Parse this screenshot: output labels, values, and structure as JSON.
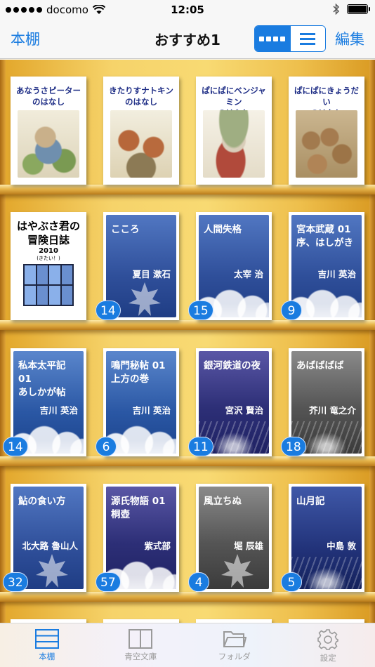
{
  "status_bar": {
    "carrier": "docomo",
    "time": "12:05"
  },
  "nav": {
    "back_label": "本棚",
    "title": "おすすめ1",
    "edit_label": "編集",
    "view_mode": "grid"
  },
  "accent_color": "#1a7ce0",
  "books": [
    {
      "title": "あなうさピーターのはなし",
      "author": "",
      "badge": ""
    },
    {
      "title": "きたりすナトキンのはなし",
      "author": "",
      "badge": ""
    },
    {
      "title": "ぱにぱにベンジャミンのはなし",
      "author": "",
      "badge": ""
    },
    {
      "title": "ぱにぱにきょうだいのはなし",
      "author": "",
      "badge": ""
    },
    {
      "title": "はやぶさ君の冒険日誌",
      "author": "",
      "badge": ""
    },
    {
      "title": "こころ",
      "author": "夏目 漱石",
      "badge": "14"
    },
    {
      "title": "人間失格",
      "author": "太宰 治",
      "badge": "15"
    },
    {
      "title": "宮本武蔵 01 序、はしがき",
      "author": "吉川 英治",
      "badge": "9"
    },
    {
      "title": "私本太平記 01 あしかが帖",
      "author": "吉川 英治",
      "badge": "14"
    },
    {
      "title": "鳴門秘帖 01 上方の巻",
      "author": "吉川 英治",
      "badge": "6"
    },
    {
      "title": "銀河鉄道の夜",
      "author": "宮沢 賢治",
      "badge": "11"
    },
    {
      "title": "あばばばば",
      "author": "芥川 竜之介",
      "badge": "18"
    },
    {
      "title": "鮎の食い方",
      "author": "北大路 魯山人",
      "badge": "32"
    },
    {
      "title": "源氏物語 01 桐壺",
      "author": "紫式部",
      "badge": "57"
    },
    {
      "title": "風立ちぬ",
      "author": "堀 辰雄",
      "badge": "4"
    },
    {
      "title": "山月記",
      "author": "中島 敦",
      "badge": "5"
    }
  ],
  "picture_books": {
    "b0": [
      "あなうさピーター",
      "のはなし"
    ],
    "b1": [
      "きたりすナトキン",
      "のはなし"
    ],
    "b2": [
      "ぱにぱにベンジャミン",
      "のはなし"
    ],
    "b3": [
      "ぱにぱにきょうだい",
      "のはなし"
    ]
  },
  "hayabusa": {
    "title_line1": "はやぶさ君の",
    "title_line2": "冒険日誌",
    "year": "2010",
    "sub": "(きたい！)"
  },
  "title_lines": {
    "b5": [
      "こころ"
    ],
    "b6": [
      "人間失格"
    ],
    "b7": [
      "宮本武蔵 01",
      "序、はしがき"
    ],
    "b8": [
      "私本太平記 01",
      "あしかが帖"
    ],
    "b9": [
      "鳴門秘帖 01",
      "上方の巻"
    ],
    "b10": [
      "銀河鉄道の夜"
    ],
    "b11": [
      "あばばばば"
    ],
    "b12": [
      "鮎の食い方"
    ],
    "b13": [
      "源氏物語 01",
      "桐壺"
    ],
    "b14": [
      "風立ちぬ"
    ],
    "b15": [
      "山月記"
    ]
  },
  "tabs": [
    {
      "label": "本棚",
      "icon": "bookshelf-icon",
      "active": true
    },
    {
      "label": "青空文庫",
      "icon": "book-open-icon",
      "active": false
    },
    {
      "label": "フォルダ",
      "icon": "folder-icon",
      "active": false
    },
    {
      "label": "設定",
      "icon": "gear-icon",
      "active": false
    }
  ]
}
